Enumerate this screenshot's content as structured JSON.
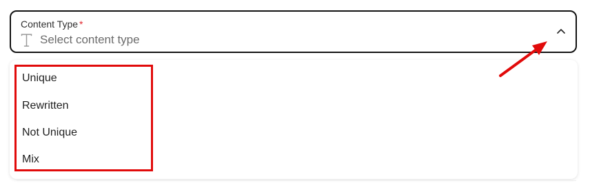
{
  "field": {
    "label": "Content Type",
    "required_mark": "*",
    "placeholder": "Select content type",
    "leading_icon": "text-type-icon",
    "trailing_icon": "chevron-up-icon"
  },
  "dropdown": {
    "options": [
      "Unique",
      "Rewritten",
      "Not Unique",
      "Mix"
    ]
  },
  "annotations": {
    "highlight_color": "#e10a0a",
    "arrow_icon": "red-arrow-icon"
  },
  "colors": {
    "required": "#e0242b",
    "border": "#111111",
    "placeholder": "#6b6b6b"
  }
}
